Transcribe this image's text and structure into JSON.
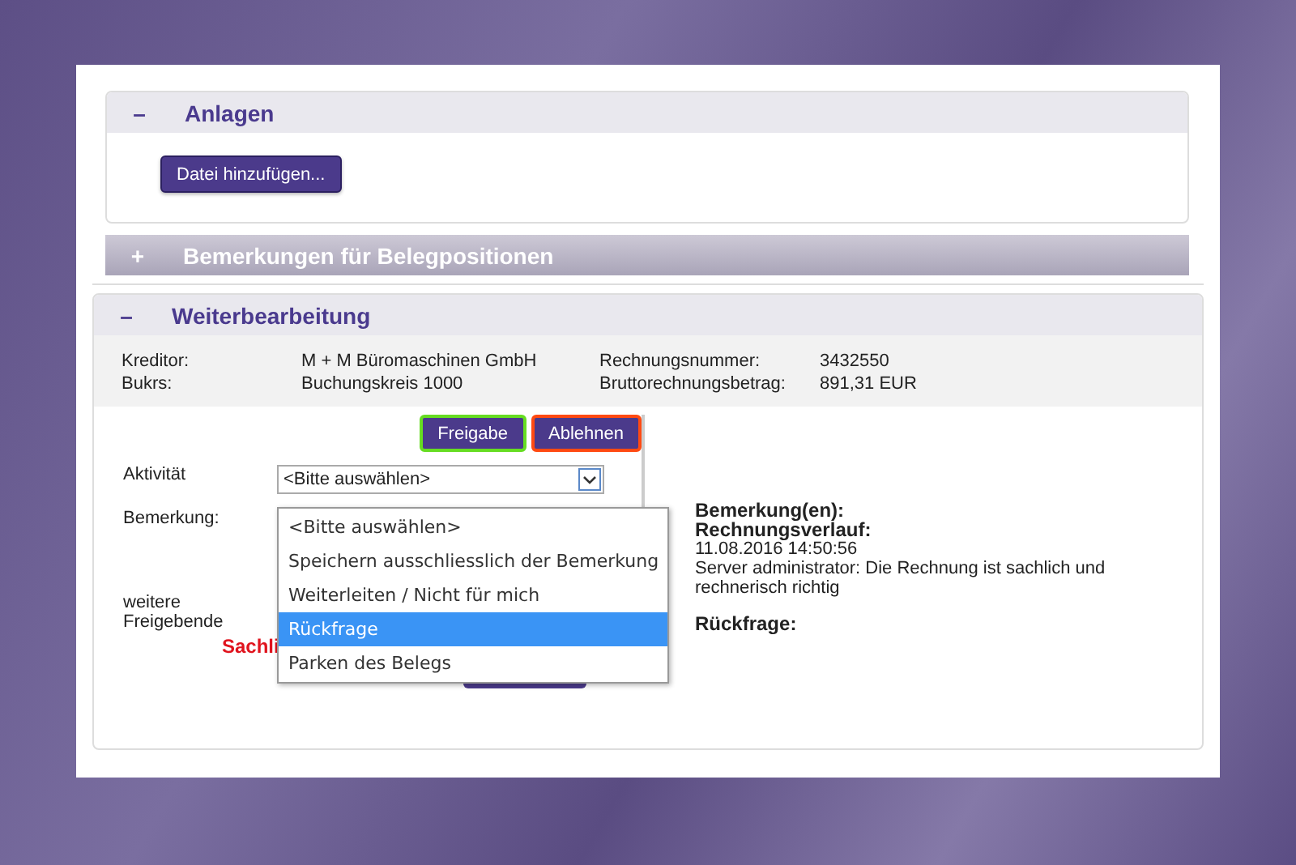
{
  "sections": [
    {
      "title": "Anlagen",
      "toggle": "–",
      "expanded": true,
      "buttons": [
        "Datei hinzufügen..."
      ]
    },
    {
      "title": "Bemerkungen für Belegpositionen",
      "toggle": "+",
      "expanded": false
    },
    {
      "title": "Weiterbearbeitung",
      "toggle": "–",
      "expanded": true
    }
  ],
  "details": [
    [
      {
        "label": "Kreditor:",
        "value": "M + M Büromaschinen GmbH"
      },
      {
        "label": "Rechnungsnummer:",
        "value": "3432550"
      }
    ],
    [
      {
        "label": "Bukrs:",
        "value": "Buchungskreis 1000"
      },
      {
        "label": "Bruttorechnungsbetrag:",
        "value": "891,31 EUR"
      }
    ]
  ],
  "actions": [
    {
      "label": "Freigabe",
      "color": "#66dd22"
    },
    {
      "label": "Ablehnen",
      "color": "#ff4a12"
    }
  ],
  "form": {
    "activity_label": "Aktivität",
    "activity_value": "<Bitte auswählen>",
    "remark_label": "Bemerkung:",
    "approvers_label": "weitere Freigebende",
    "warning": "Sachli"
  },
  "dropdown": {
    "expanded": true,
    "options": [
      {
        "label": "<Bitte auswählen>",
        "selected": false
      },
      {
        "label": "Speichern ausschliesslich der Bemerkung",
        "selected": false
      },
      {
        "label": "Weiterleiten / Nicht für mich",
        "selected": false
      },
      {
        "label": "Rückfrage",
        "selected": true
      },
      {
        "label": "Parken des Belegs",
        "selected": false
      }
    ]
  },
  "history": [
    {
      "kind": "heading",
      "text": "Bemerkung(en):"
    },
    {
      "kind": "heading",
      "text": "Rechnungsverlauf:"
    },
    {
      "kind": "text",
      "text": "11.08.2016 14:50:56"
    },
    {
      "kind": "text",
      "text": "Server administrator: Die Rechnung ist sachlich und rechnerisch richtig"
    },
    {
      "kind": "gap_heading",
      "text": "Rückfrage:"
    }
  ]
}
